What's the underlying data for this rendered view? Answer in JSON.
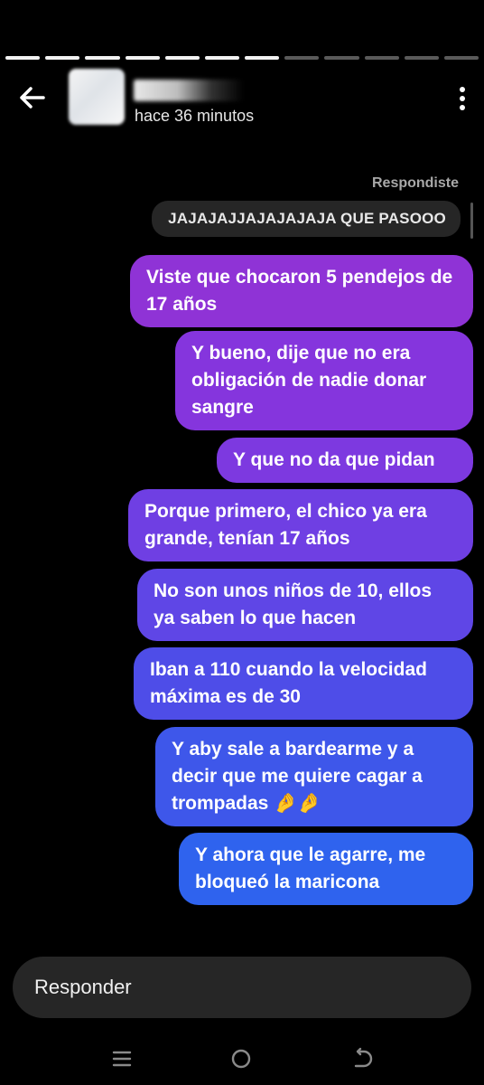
{
  "story_progress": {
    "total": 12,
    "completed": 7
  },
  "header": {
    "time_ago": "hace 36 minutos"
  },
  "chat": {
    "reply_label": "Respondiste",
    "quoted_story_text": "JAJAJAJJAJAJAJAJA QUE PASOOO",
    "messages": [
      {
        "text": "Viste que chocaron 5 pendejos de 17 años",
        "color": "#8f33d6"
      },
      {
        "text": "Y bueno, dije que no era obligación de nadie donar sangre",
        "color": "#8535dd"
      },
      {
        "text": "Y que no da que pidan",
        "color": "#7d39e0"
      },
      {
        "text": "Porque primero, el chico ya era grande, tenían 17 años",
        "color": "#6f3fe3"
      },
      {
        "text": "No son unos niños de 10, ellos ya saben lo que hacen",
        "color": "#5f46e6"
      },
      {
        "text": "Iban a 110 cuando la velocidad máxima es de 30",
        "color": "#4e4de8"
      },
      {
        "text": "Y aby sale a bardearme y a decir que me quiere cagar a trompadas 🤌🤌",
        "color": "#3e57ea"
      },
      {
        "text": "Y ahora que le agarre, me bloqueó la maricona",
        "color": "#2f63ee"
      }
    ]
  },
  "composer": {
    "placeholder": "Responder"
  },
  "icons": {
    "back": "arrow-left-icon",
    "more": "vertical-dots-icon",
    "nav_recents": "recents-icon",
    "nav_home": "home-icon",
    "nav_back": "back-gesture-icon"
  }
}
